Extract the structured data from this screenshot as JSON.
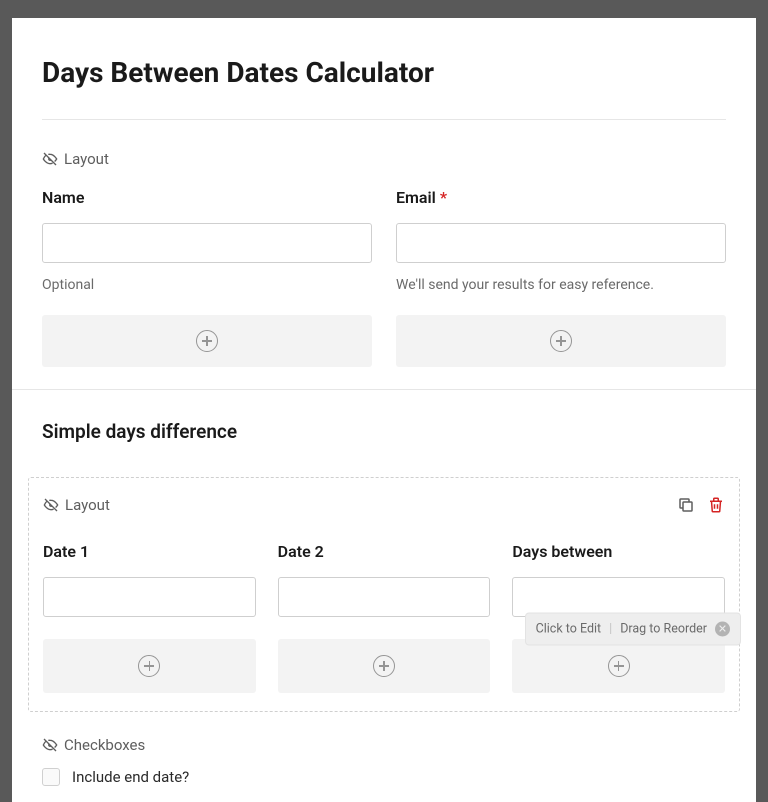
{
  "form": {
    "title": "Days Between Dates Calculator"
  },
  "layout1": {
    "type_label": "Layout",
    "fields": {
      "name": {
        "label": "Name",
        "help": "Optional"
      },
      "email": {
        "label": "Email",
        "required": "*",
        "help": "We'll send your results for easy reference."
      }
    }
  },
  "section": {
    "title": "Simple days difference"
  },
  "layout2": {
    "type_label": "Layout",
    "fields": {
      "date1": {
        "label": "Date 1"
      },
      "date2": {
        "label": "Date 2"
      },
      "days_between": {
        "label": "Days between"
      }
    },
    "hint": {
      "edit": "Click to Edit",
      "reorder": "Drag to Reorder"
    }
  },
  "checkboxes": {
    "type_label": "Checkboxes",
    "items": [
      {
        "label": "Include end date?",
        "checked": false
      }
    ]
  }
}
